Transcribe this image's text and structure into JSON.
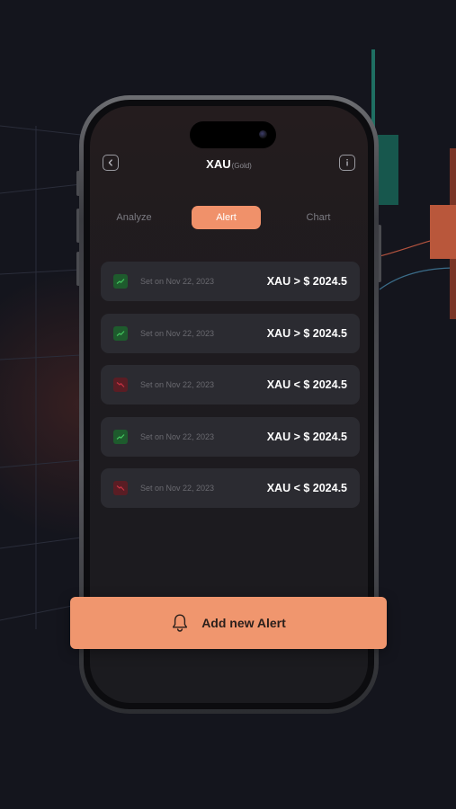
{
  "header": {
    "title": "XAU",
    "subtitle": "(Gold)",
    "back_icon": "chevron-left-icon",
    "info_icon": "info-icon"
  },
  "tabs": [
    {
      "label": "Analyze",
      "active": false
    },
    {
      "label": "Alert",
      "active": true
    },
    {
      "label": "Chart",
      "active": false
    }
  ],
  "alerts": [
    {
      "direction": "up",
      "date": "Set on Nov 22, 2023",
      "condition": "XAU > $ 2024.5"
    },
    {
      "direction": "up",
      "date": "Set on Nov 22, 2023",
      "condition": "XAU > $ 2024.5"
    },
    {
      "direction": "down",
      "date": "Set on Nov 22, 2023",
      "condition": "XAU < $ 2024.5"
    },
    {
      "direction": "up",
      "date": "Set on Nov 22, 2023",
      "condition": "XAU > $ 2024.5"
    },
    {
      "direction": "down",
      "date": "Set on Nov 22, 2023",
      "condition": "XAU < $ 2024.5"
    }
  ],
  "add_button": {
    "label": "Add new Alert",
    "icon": "bell-icon"
  },
  "colors": {
    "accent": "#f0916a",
    "up": "#3fc15a",
    "down": "#c53242",
    "background": "#14151d"
  }
}
